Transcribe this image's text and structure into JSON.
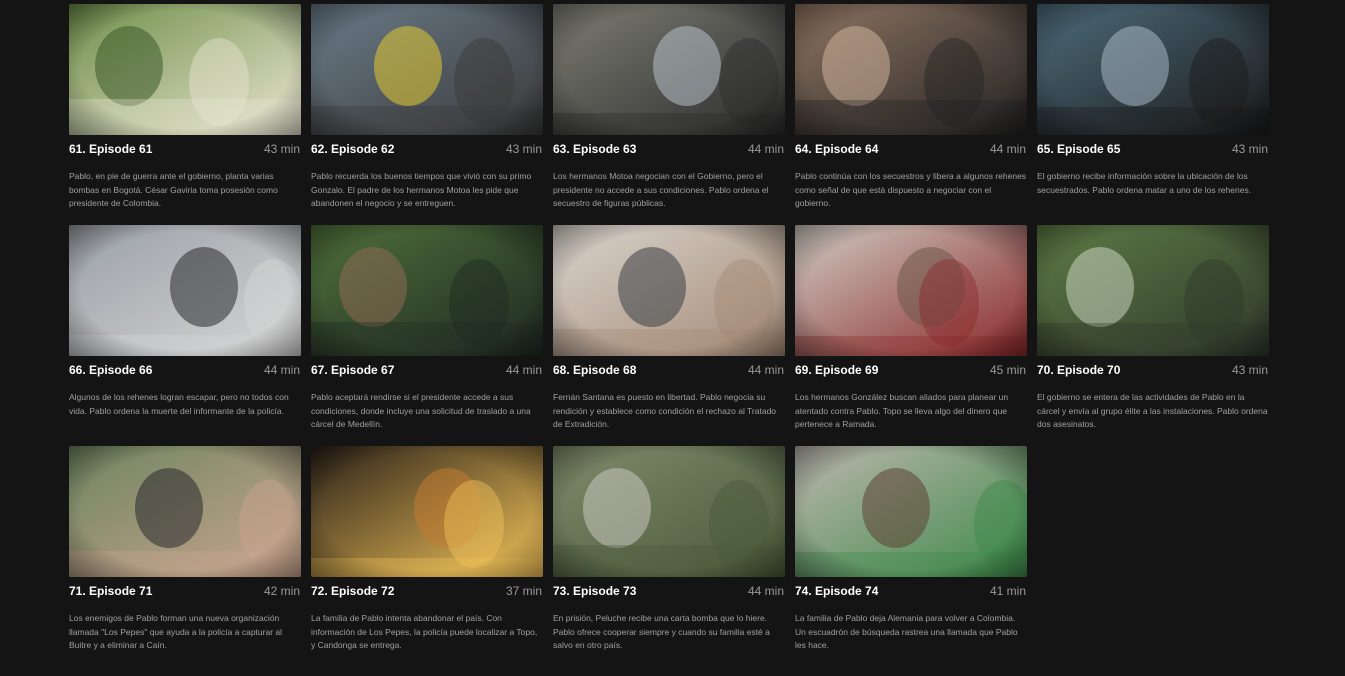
{
  "episodes": [
    {
      "title": "61. Episode 61",
      "duration": "43 min",
      "synopsis": "Pablo, en pie de guerra ante el gobierno, planta varias bombas en Bogotá. César Gaviria toma posesión como presidente de Colombia.",
      "palette": [
        "#6f8f4a",
        "#3e5a2a",
        "#e9e4d0"
      ]
    },
    {
      "title": "62. Episode 62",
      "duration": "43 min",
      "synopsis": "Pablo recuerda los buenos tiempos que vivió con su primo Gonzalo. El padre de los hermanos Motoa les pide que abandonen el negocio y se entreguen.",
      "palette": [
        "#6a7b88",
        "#e1c832",
        "#3a3a3a"
      ]
    },
    {
      "title": "63. Episode 63",
      "duration": "44 min",
      "synopsis": "Los hermanos Motoa negocian con el Gobierno, pero el presidente no accede a sus condiciones. Pablo ordena el secuestro de figuras públicas.",
      "palette": [
        "#7d7d74",
        "#b7c0c9",
        "#2c2c2c"
      ]
    },
    {
      "title": "64. Episode 64",
      "duration": "44 min",
      "synopsis": "Pablo continúa con los secuestros y libera a algunos rehenes como señal de que está dispuesto a negociar con el gobierno.",
      "palette": [
        "#8d7461",
        "#cfb39a",
        "#232323"
      ]
    },
    {
      "title": "65. Episode 65",
      "duration": "43 min",
      "synopsis": "El gobierno recibe información sobre la ubicación de los secuestrados. Pablo ordena matar a uno de los rehenes.",
      "palette": [
        "#4d6b7a",
        "#a6b7c2",
        "#1b1b1b"
      ]
    },
    {
      "title": "66. Episode 66",
      "duration": "44 min",
      "synopsis": "Algunos de los rehenes logran escapar, pero no todos con vida. Pablo ordena la muerte del informante de la policía.",
      "palette": [
        "#9aa0a6",
        "#2b2b2b",
        "#d6d6d6"
      ]
    },
    {
      "title": "67. Episode 67",
      "duration": "44 min",
      "synopsis": "Pablo aceptará rendirse si el presidente accede a sus condiciones, donde incluye una solicitud de traslado a una cárcel de Medellín.",
      "palette": [
        "#4f6f3a",
        "#8c6a54",
        "#1f2a22"
      ]
    },
    {
      "title": "68. Episode 68",
      "duration": "44 min",
      "synopsis": "Fernán Santana es puesto en libertad. Pablo negocia su rendición y establece como condición el rechazo al Tratado de Extradición.",
      "palette": [
        "#d8d3cc",
        "#3b3f46",
        "#a48a76"
      ]
    },
    {
      "title": "69. Episode 69",
      "duration": "45 min",
      "synopsis": "Los hermanos González buscan aliados para planear un atentado contra Pablo. Topo se lleva algo del dinero que pertenece a Ramada.",
      "palette": [
        "#cfcac2",
        "#6e5a48",
        "#8a2a2a"
      ]
    },
    {
      "title": "70. Episode 70",
      "duration": "43 min",
      "synopsis": "El gobierno se entera de las actividades de Pablo en la cárcel y envía al grupo élite a las instalaciones. Pablo ordena dos asesinatos.",
      "palette": [
        "#5e7a45",
        "#c9d3bd",
        "#2f3a2b"
      ]
    },
    {
      "title": "71. Episode 71",
      "duration": "42 min",
      "synopsis": "Los enemigos de Pablo forman una nueva organización llamada \"Los Pepes\" que ayuda a la policía a capturar al Buitre y a eliminar a Caín.",
      "palette": [
        "#6f8560",
        "#2a2a2e",
        "#c9a58f"
      ]
    },
    {
      "title": "72. Episode 72",
      "duration": "37 min",
      "synopsis": "La familia de Pablo intenta abandonar el país. Con información de Los Pepes, la policía puede localizar a Topo, y Candonga se entrega.",
      "palette": [
        "#2a2118",
        "#c07a32",
        "#f2c35a"
      ]
    },
    {
      "title": "73. Episode 73",
      "duration": "44 min",
      "synopsis": "En prisión, Peluche recibe una carta bomba que lo hiere. Pablo ofrece cooperar siempre y cuando su familia esté a salvo en otro país.",
      "palette": [
        "#7f8a6a",
        "#c9c7c0",
        "#4a5a3a"
      ]
    },
    {
      "title": "74. Episode 74",
      "duration": "41 min",
      "synopsis": "La familia de Pablo deja Alemania para volver a Colombia. Un escuadrón de búsqueda rastrea una llamada que Pablo les hace.",
      "palette": [
        "#bcb6ad",
        "#5c4434",
        "#3f8a4a"
      ]
    }
  ]
}
